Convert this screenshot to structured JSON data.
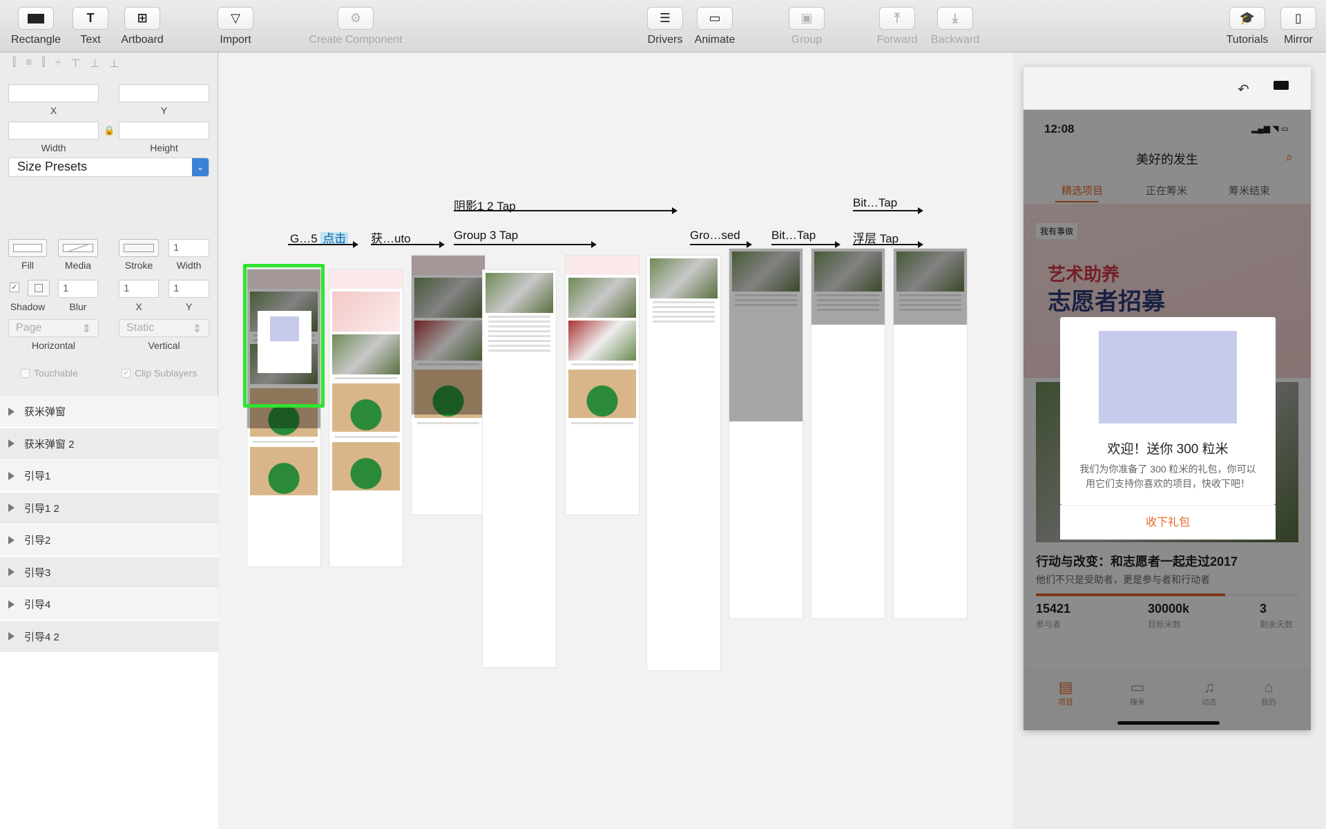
{
  "toolbar": {
    "rectangle": "Rectangle",
    "text": "Text",
    "artboard": "Artboard",
    "import": "Import",
    "create_component": "Create Component",
    "drivers": "Drivers",
    "animate": "Animate",
    "group": "Group",
    "forward": "Forward",
    "backward": "Backward",
    "tutorials": "Tutorials",
    "mirror": "Mirror"
  },
  "inspector": {
    "x_label": "X",
    "y_label": "Y",
    "width_label": "Width",
    "height_label": "Height",
    "size_presets": "Size Presets",
    "fill_label": "Fill",
    "media_label": "Media",
    "stroke_label": "Stroke",
    "stroke_width_label": "Width",
    "stroke_width_value": "1",
    "shadow_label": "Shadow",
    "blur_label": "Blur",
    "blur_value": "1",
    "shadow_x_label": "X",
    "shadow_x_value": "1",
    "shadow_y_label": "Y",
    "shadow_y_value": "1",
    "horizontal_value": "Page",
    "horizontal_label": "Horizontal",
    "vertical_value": "Static",
    "vertical_label": "Vertical",
    "touchable_label": "Touchable",
    "clip_sublayers_label": "Clip Sublayers"
  },
  "layers": [
    "获米弹窗",
    "获米弹窗 2",
    "引导1",
    "引导1 2",
    "引导2",
    "引导3",
    "引导4",
    "引导4 2"
  ],
  "flows": {
    "f1": "G…5",
    "f1_tap": "点击",
    "f2": "获…uto",
    "f3": "阴影1 2 Tap",
    "f4": "Group 3 Tap",
    "f5": "Gro…sed",
    "f6": "Bit…Tap",
    "f7": "Bit…Tap",
    "f8": "浮层 Tap"
  },
  "device": {
    "time": "12:08",
    "title": "美好的发生",
    "tabs": [
      "精选项目",
      "正在筹米",
      "筹米结束"
    ],
    "tag": "我有事做",
    "banner_line1": "艺术助养",
    "banner_line2": "志愿者招募",
    "modal_title": "欢迎！送你 300 粒米",
    "modal_body_line1": "我们为你准备了 300 粒米的礼包，你可以",
    "modal_body_line2": "用它们支持你喜欢的项目，快收下吧！",
    "modal_button": "收下礼包",
    "article_title": "行动与改变：和志愿者一起走过2017",
    "article_sub": "他们不只是受助者，更是参与者和行动者",
    "stat1_value": "15421",
    "stat1_label": "参与者",
    "stat2_value": "30000k",
    "stat2_label": "目标米数",
    "stat3_value": "3",
    "stat3_label": "剩余天数",
    "nav": [
      "项目",
      "赚米",
      "动态",
      "我的"
    ],
    "accent": "#e8692b"
  }
}
